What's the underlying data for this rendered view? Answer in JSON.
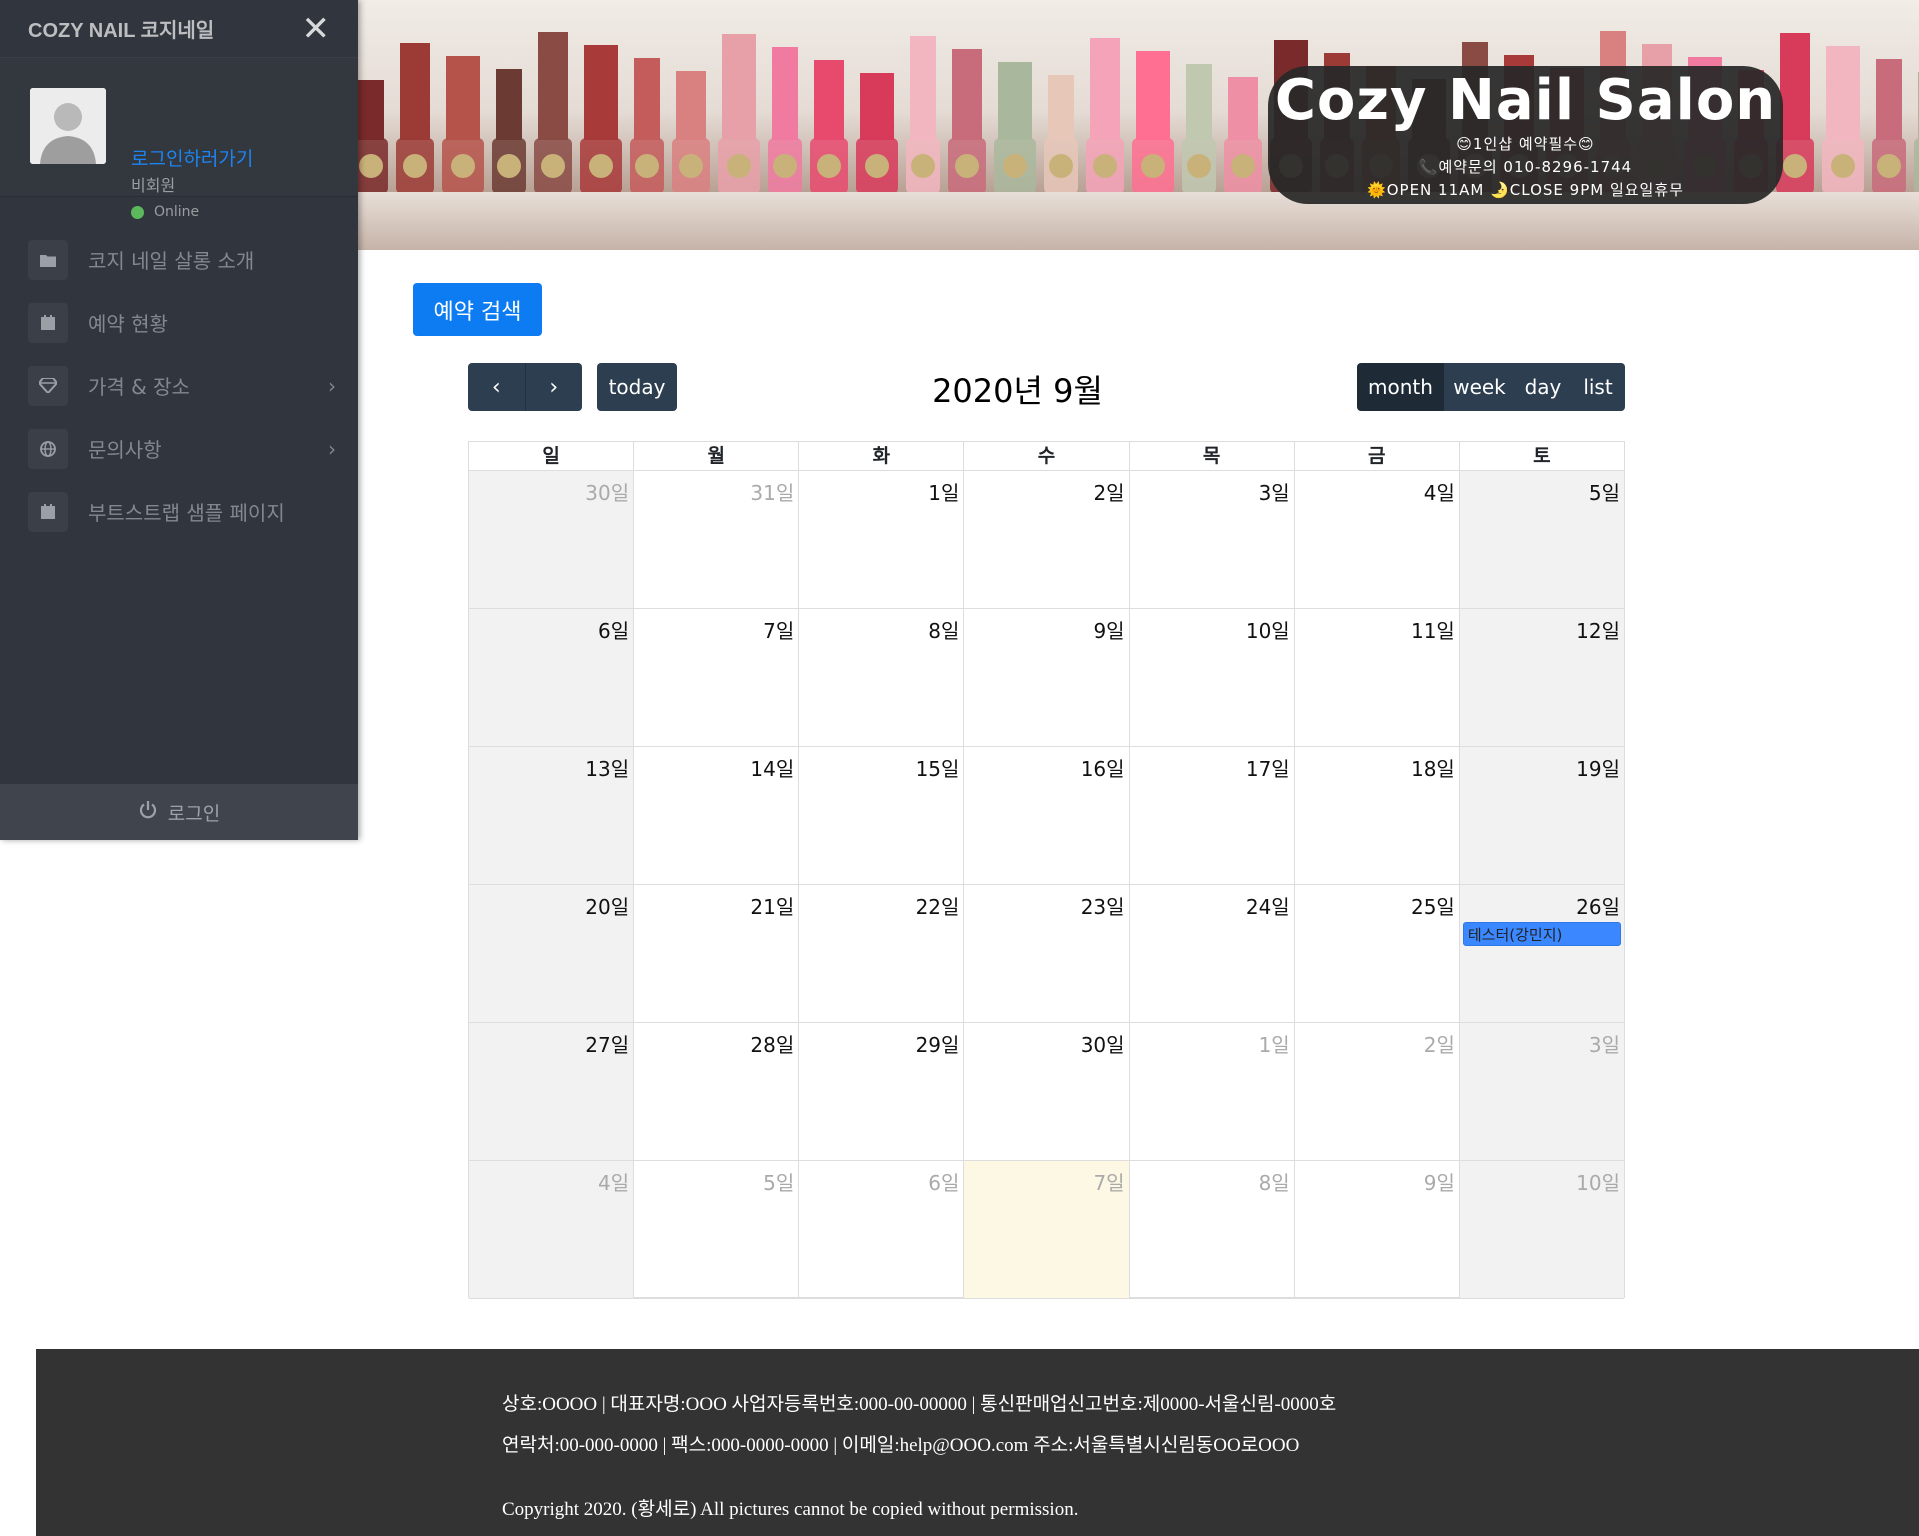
{
  "sidebar": {
    "brand": "COZY NAIL 코지네일",
    "user": {
      "login_link": "로그인하러가기",
      "role": "비회원",
      "status": "Online"
    },
    "items": [
      {
        "label": "코지 네일 살롱 소개",
        "icon": "folder-icon",
        "has_chevron": false
      },
      {
        "label": "예약 현황",
        "icon": "calendar-icon",
        "has_chevron": false
      },
      {
        "label": "가격 & 장소",
        "icon": "diamond-icon",
        "has_chevron": true
      },
      {
        "label": "문의사항",
        "icon": "globe-icon",
        "has_chevron": true
      },
      {
        "label": "부트스트랩 샘플 페이지",
        "icon": "calendar-icon",
        "has_chevron": false
      }
    ],
    "footer_label": "로그인"
  },
  "banner": {
    "title": "Cozy Nail Salon",
    "line1": "😊1인샵 예약필수😊",
    "line2": "📞예약문의 010-8296-1744",
    "line3": "🌞OPEN 11AM 🌛CLOSE 9PM 일요일휴무"
  },
  "main": {
    "search_button": "예약 검색",
    "calendar": {
      "title": "2020년 9월",
      "prev_icon": "‹",
      "next_icon": "›",
      "today_label": "today",
      "views": [
        "month",
        "week",
        "day",
        "list"
      ],
      "active_view": "month",
      "weekdays": [
        "일",
        "월",
        "화",
        "수",
        "목",
        "금",
        "토"
      ],
      "weeks": [
        [
          {
            "d": "30일",
            "o": true
          },
          {
            "d": "31일",
            "o": true
          },
          {
            "d": "1일"
          },
          {
            "d": "2일"
          },
          {
            "d": "3일"
          },
          {
            "d": "4일"
          },
          {
            "d": "5일"
          }
        ],
        [
          {
            "d": "6일"
          },
          {
            "d": "7일"
          },
          {
            "d": "8일"
          },
          {
            "d": "9일"
          },
          {
            "d": "10일"
          },
          {
            "d": "11일"
          },
          {
            "d": "12일"
          }
        ],
        [
          {
            "d": "13일"
          },
          {
            "d": "14일"
          },
          {
            "d": "15일"
          },
          {
            "d": "16일"
          },
          {
            "d": "17일"
          },
          {
            "d": "18일"
          },
          {
            "d": "19일"
          }
        ],
        [
          {
            "d": "20일"
          },
          {
            "d": "21일"
          },
          {
            "d": "22일"
          },
          {
            "d": "23일"
          },
          {
            "d": "24일"
          },
          {
            "d": "25일"
          },
          {
            "d": "26일",
            "event": "테스터(강민지)"
          }
        ],
        [
          {
            "d": "27일"
          },
          {
            "d": "28일"
          },
          {
            "d": "29일"
          },
          {
            "d": "30일"
          },
          {
            "d": "1일",
            "o": true
          },
          {
            "d": "2일",
            "o": true
          },
          {
            "d": "3일",
            "o": true
          }
        ],
        [
          {
            "d": "4일",
            "o": true
          },
          {
            "d": "5일",
            "o": true
          },
          {
            "d": "6일",
            "o": true
          },
          {
            "d": "7일",
            "o": true,
            "today": true
          },
          {
            "d": "8일",
            "o": true
          },
          {
            "d": "9일",
            "o": true
          },
          {
            "d": "10일",
            "o": true
          }
        ]
      ]
    }
  },
  "footer": {
    "line1": "상호:OOOO | 대표자명:OOO 사업자등록번호:000-00-00000 | 통신판매업신고번호:제0000-서울신림-0000호",
    "line2": "연락처:00-000-0000 | 팩스:000-0000-0000 | 이메일:help@OOO.com 주소:서울특별시신림동OO로OOO",
    "line3": "Copyright 2020. (황세로) All pictures cannot be copied without permission."
  },
  "colors": {
    "sidebar_bg": "#31353d",
    "primary_button": "#0d7cf2",
    "calendar_button": "#2c3e50",
    "event": "#3a87ff",
    "today_cell": "#fcf8e3",
    "footer_bg": "#333333"
  }
}
